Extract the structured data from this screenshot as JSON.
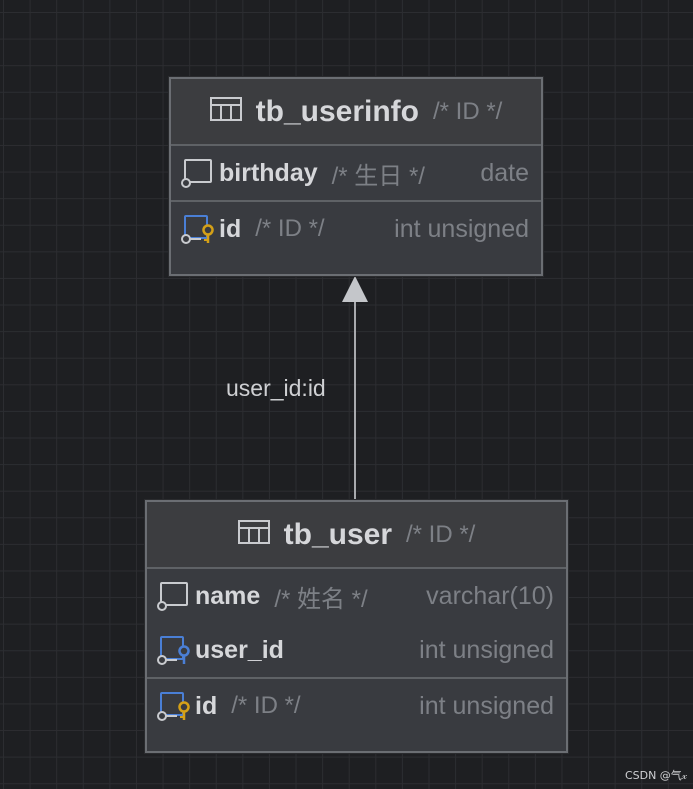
{
  "entities": {
    "userinfo": {
      "name": "tb_userinfo",
      "comment": "/* ID */",
      "columns": [
        {
          "name": "birthday",
          "comment": "/* 生日 */",
          "type": "date",
          "icon": "column-icon"
        },
        {
          "name": "id",
          "comment": "/* ID */",
          "type": "int unsigned",
          "icon": "primary-key-column-icon"
        }
      ]
    },
    "user": {
      "name": "tb_user",
      "comment": "/* ID */",
      "columns": [
        {
          "name": "name",
          "comment": "/* 姓名 */",
          "type": "varchar(10)",
          "icon": "column-icon"
        },
        {
          "name": "user_id",
          "comment": "",
          "type": "int unsigned",
          "icon": "foreign-key-column-icon"
        },
        {
          "name": "id",
          "comment": "/* ID */",
          "type": "int unsigned",
          "icon": "primary-key-column-icon"
        }
      ]
    }
  },
  "relation": {
    "label": "user_id:id",
    "from": "tb_user",
    "to": "tb_userinfo"
  },
  "colors": {
    "background": "#1e1f22",
    "entity_fill": "#393b40",
    "key_gold": "#d4a017",
    "column_blue": "#4a7fd6"
  },
  "watermark": "CSDN @气𝓍"
}
